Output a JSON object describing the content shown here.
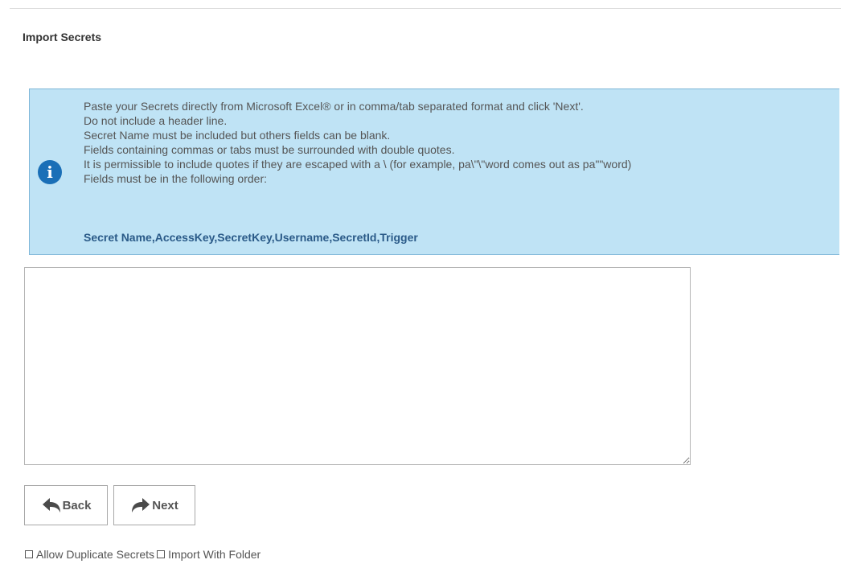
{
  "page": {
    "title": "Import Secrets"
  },
  "info": {
    "lines": [
      "Paste your Secrets directly from Microsoft Excel® or in comma/tab separated format and click 'Next'.",
      "Do not include a header line.",
      "Secret Name must be included but others fields can be blank.",
      "Fields containing commas or tabs must be surrounded with double quotes.",
      "It is permissible to include quotes if they are escaped with a \\ (for example, pa\\\"\\\"word comes out as pa\"\"word)",
      "Fields must be in the following order:"
    ],
    "fields": "Secret Name,AccessKey,SecretKey,Username,SecretId,Trigger",
    "icon": "info-icon",
    "accent_color": "#1a6fb7",
    "background_color": "#bfe3f5"
  },
  "paste_area": {
    "value": ""
  },
  "buttons": {
    "back_label": "Back",
    "back_icon": "reply-arrow-icon",
    "next_label": "Next",
    "next_icon": "forward-arrow-icon"
  },
  "options": {
    "allow_duplicates_label": "Allow Duplicate Secrets",
    "allow_duplicates_checked": false,
    "import_with_folder_label": "Import With Folder",
    "import_with_folder_checked": false
  }
}
